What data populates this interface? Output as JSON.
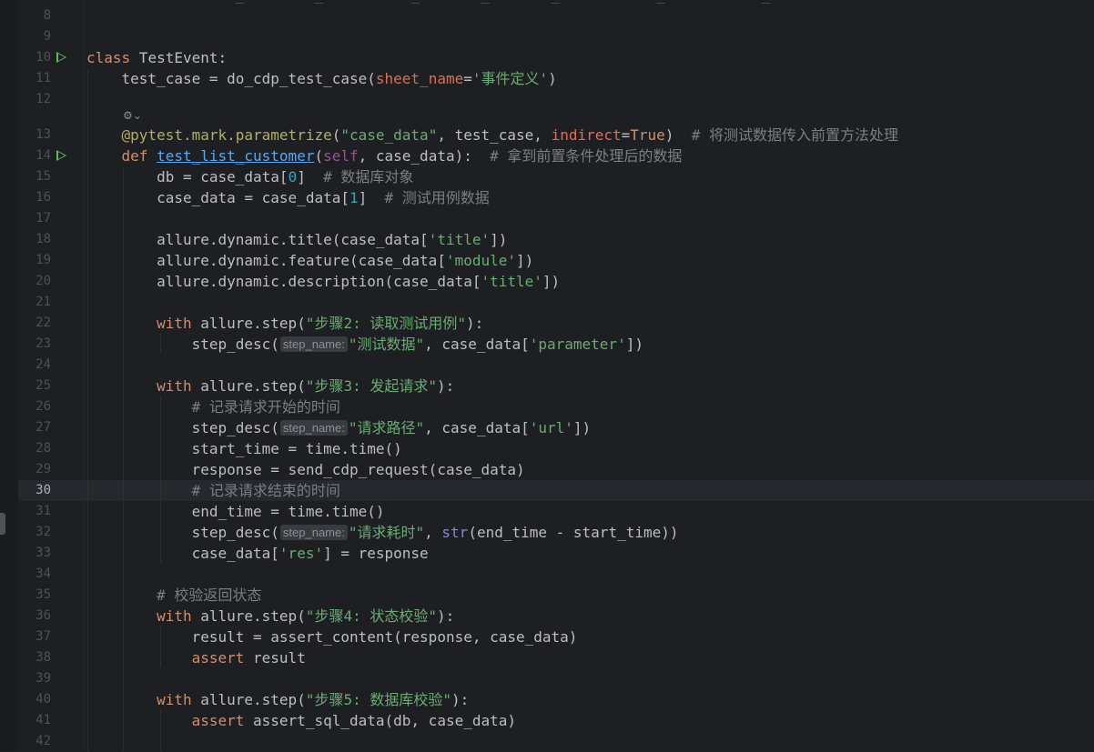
{
  "editor": {
    "current_line": "30",
    "gutter_lines": [
      "8",
      "9",
      "10",
      "11",
      "12",
      "13",
      "14",
      "15",
      "16",
      "17",
      "18",
      "19",
      "20",
      "21",
      "22",
      "23",
      "24",
      "25",
      "26",
      "27",
      "28",
      "29",
      "30",
      "31",
      "32",
      "33",
      "34",
      "35",
      "36",
      "37",
      "38",
      "39",
      "40",
      "41",
      "42"
    ],
    "run_gutter_icons": [
      "run-icon",
      "run-icon"
    ],
    "inlay_hint_label": "step_name:",
    "inlay_author_icon": "ai-suggestion-icon",
    "code": {
      "l10_kw": "class",
      "l10_name": " TestEvent:",
      "l11_a": "    test_case = do_cdp_test_case(",
      "l11_param": "sheet_name",
      "l11_eq": "=",
      "l11_str": "'事件定义'",
      "l11_end": ")",
      "l13_deco": "    @pytest.mark.parametrize",
      "l13_a": "(",
      "l13_str": "\"case_data\"",
      "l13_b": ", test_case, ",
      "l13_param": "indirect",
      "l13_eq": "=",
      "l13_true": "True",
      "l13_c": ")  ",
      "l13_cmt": "# 将测试数据传入前置方法处理",
      "l14_kw": "    def ",
      "l14_fn": "test_list_customer",
      "l14_a": "(",
      "l14_self": "self",
      "l14_b": ", case_data):  ",
      "l14_cmt": "# 拿到前置条件处理后的数据",
      "l15_a": "        db = case_data[",
      "l15_num": "0",
      "l15_b": "]  ",
      "l15_cmt": "# 数据库对象",
      "l16_a": "        case_data = case_data[",
      "l16_num": "1",
      "l16_b": "]  ",
      "l16_cmt": "# 测试用例数据",
      "l18_a": "        allure.dynamic.title(case_data[",
      "l18_str": "'title'",
      "l18_b": "])",
      "l19_a": "        allure.dynamic.feature(case_data[",
      "l19_str": "'module'",
      "l19_b": "])",
      "l20_a": "        allure.dynamic.description(case_data[",
      "l20_str": "'title'",
      "l20_b": "])",
      "l22_kw": "        with",
      "l22_a": " allure.step(",
      "l22_str": "\"步骤2: 读取测试用例\"",
      "l22_b": "):",
      "l23_a": "            step_desc(",
      "l23_str": "\"测试数据\"",
      "l23_b": ", case_data[",
      "l23_str2": "'parameter'",
      "l23_c": "])",
      "l25_kw": "        with",
      "l25_a": " allure.step(",
      "l25_str": "\"步骤3: 发起请求\"",
      "l25_b": "):",
      "l26_cmt": "            # 记录请求开始的时间",
      "l27_a": "            step_desc(",
      "l27_str": "\"请求路径\"",
      "l27_b": ", case_data[",
      "l27_str2": "'url'",
      "l27_c": "])",
      "l28_a": "            start_time = time.time()",
      "l29_a": "            response = send_cdp_request(case_data)",
      "l30_cmt": "            # 记录请求结束的时间",
      "l31_a": "            end_time = time.time()",
      "l32_a": "            step_desc(",
      "l32_str": "\"请求耗时\"",
      "l32_b": ", ",
      "l32_builtin": "str",
      "l32_c": "(end_time - start_time))",
      "l33_a": "            case_data[",
      "l33_str": "'res'",
      "l33_b": "] = response",
      "l35_cmt": "        # 校验返回状态",
      "l36_kw": "        with",
      "l36_a": " allure.step(",
      "l36_str": "\"步骤4: 状态校验\"",
      "l36_b": "):",
      "l37_a": "            result = assert_content(response, case_data)",
      "l38_kw": "            assert",
      "l38_a": " result",
      "l40_kw": "        with",
      "l40_a": " allure.step(",
      "l40_str": "\"步骤5: 数据库校验\"",
      "l40_b": "):",
      "l41_kw": "            assert",
      "l41_a": " assert_sql_data(db, case_data)"
    }
  }
}
